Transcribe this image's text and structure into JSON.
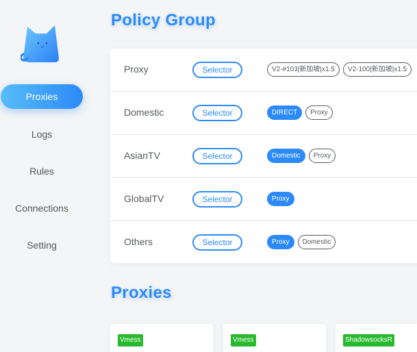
{
  "sidebar": {
    "logo_icon": "cat-logo-icon",
    "items": [
      {
        "label": "Proxies",
        "active": true
      },
      {
        "label": "Logs",
        "active": false
      },
      {
        "label": "Rules",
        "active": false
      },
      {
        "label": "Connections",
        "active": false
      },
      {
        "label": "Setting",
        "active": false
      }
    ]
  },
  "policy_group": {
    "title": "Policy Group",
    "groups": [
      {
        "name": "Proxy",
        "type": "Selector",
        "options": [
          "V2-#103|新加坡|x1.5",
          "V2-100|新加坡|x1.5"
        ]
      },
      {
        "name": "Domestic",
        "type": "Selector",
        "options": [
          "DIRECT",
          "Proxy"
        ]
      },
      {
        "name": "AsianTV",
        "type": "Selector",
        "options": [
          "Domestic",
          "Proxy"
        ]
      },
      {
        "name": "GlobalTV",
        "type": "Selector",
        "options": [
          "Proxy"
        ]
      },
      {
        "name": "Others",
        "type": "Selector",
        "options": [
          "Proxy",
          "Domestic"
        ]
      }
    ]
  },
  "proxies": {
    "title": "Proxies",
    "items": [
      {
        "type": "Vmess"
      },
      {
        "type": "Vmess"
      },
      {
        "type": "ShadowsocksR"
      }
    ]
  },
  "colors": {
    "accent": "#2c8af8",
    "badge_green": "#28b92e",
    "background": "#f4f5f6"
  }
}
